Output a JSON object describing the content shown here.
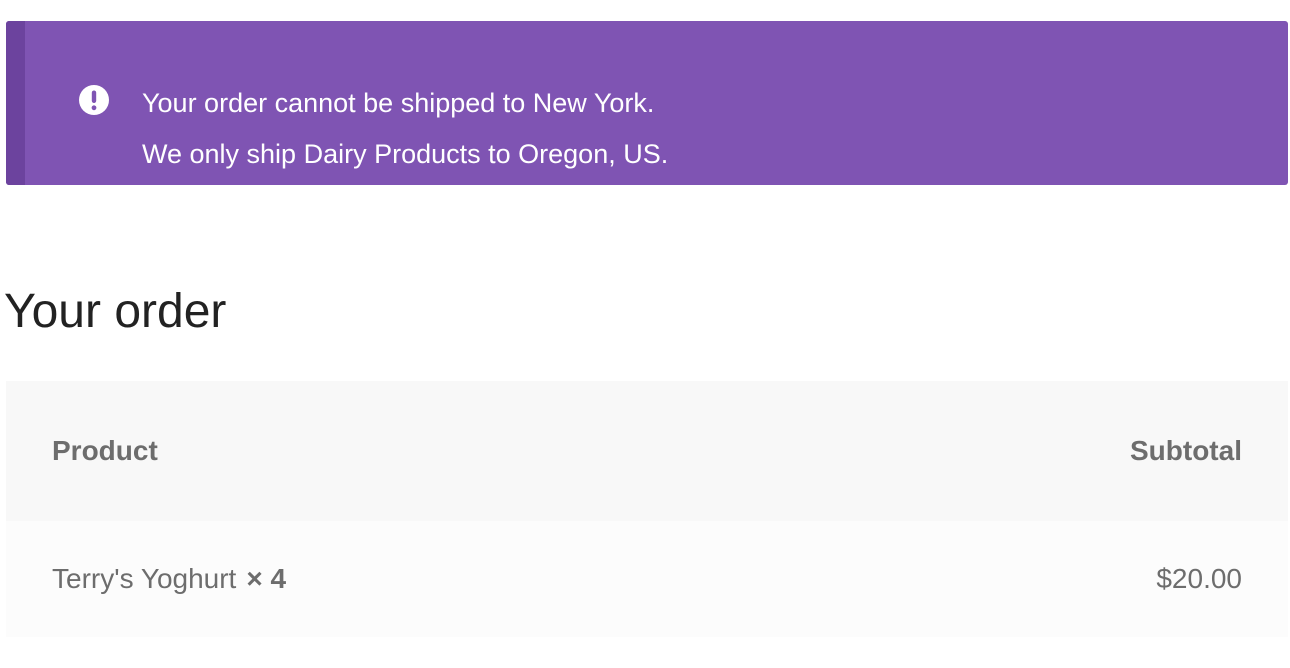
{
  "notice": {
    "line1": "Your order cannot be shipped to New York.",
    "line2": "We only ship Dairy Products to Oregon, US.",
    "icon": "exclamation-circle-icon",
    "bg_color": "#7f54b3",
    "accent_color": "#6c439e"
  },
  "order": {
    "title": "Your order",
    "columns": {
      "product": "Product",
      "subtotal": "Subtotal"
    },
    "items": [
      {
        "name": "Terry's Yoghurt",
        "qty": "× 4",
        "subtotal": "$20.00"
      }
    ]
  }
}
